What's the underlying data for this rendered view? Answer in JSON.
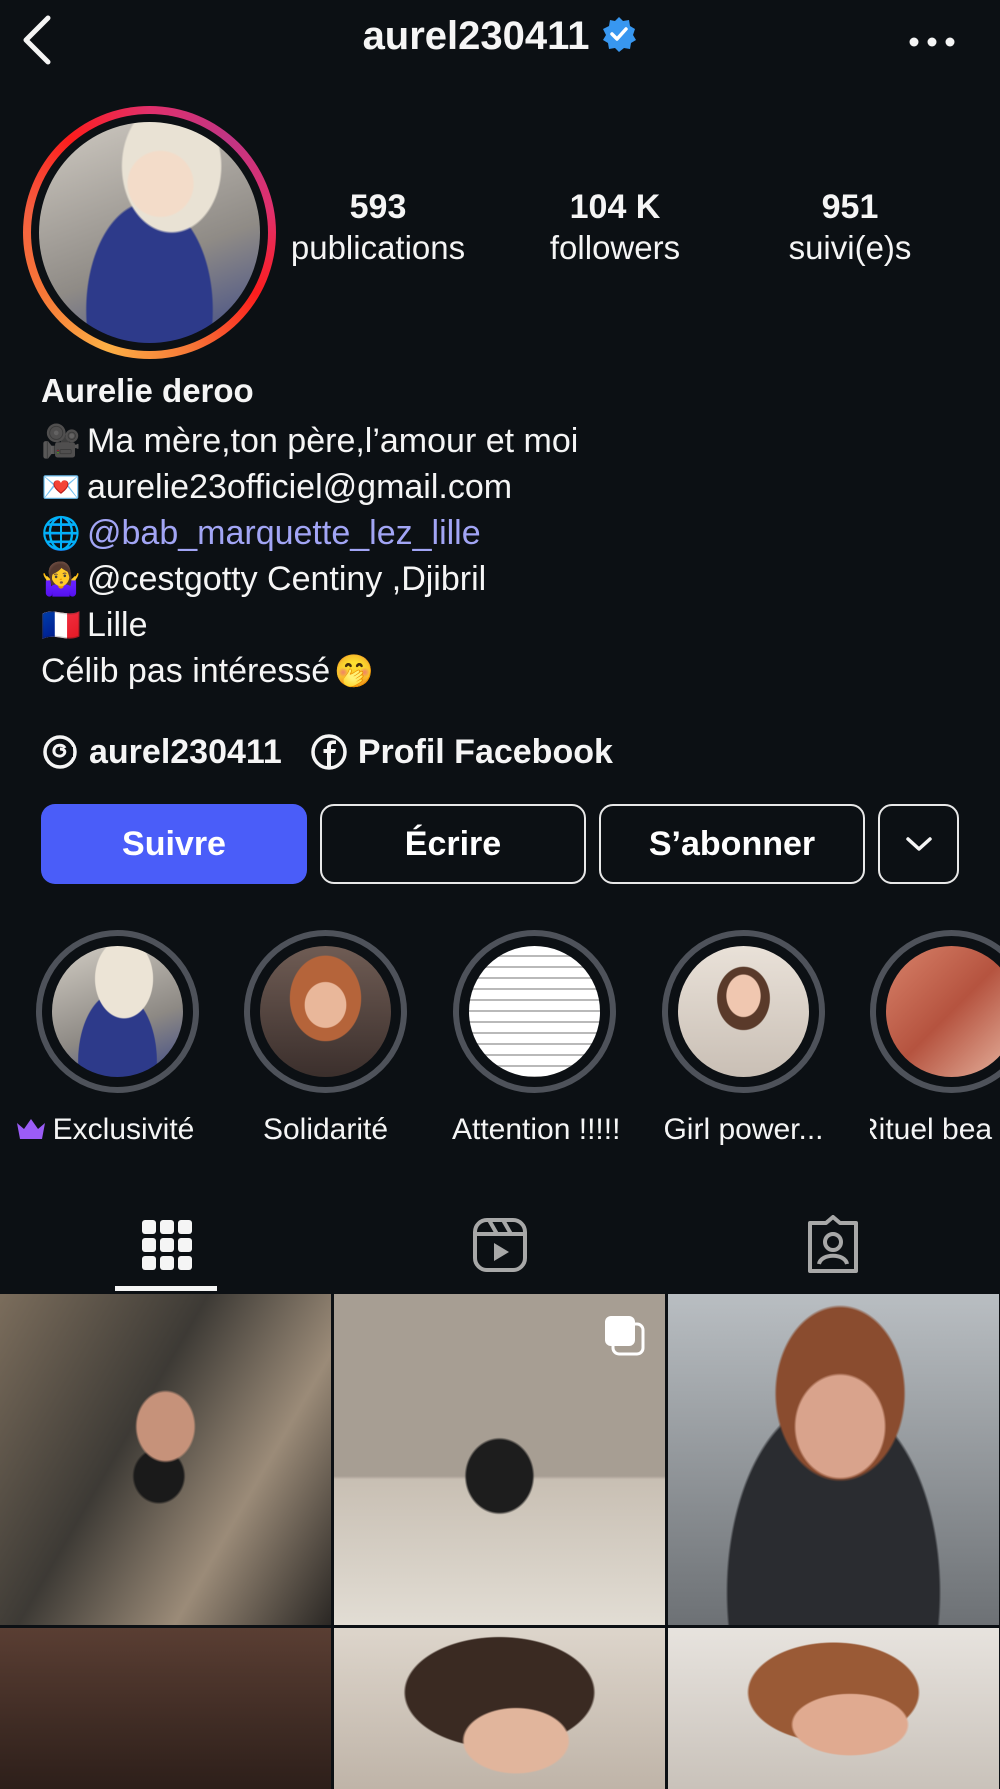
{
  "header": {
    "back_icon": "chevron-left-icon",
    "username": "aurel230411",
    "verified_icon": "verified-badge-icon",
    "verified_color": "#3897f0",
    "more_icon": "more-horizontal-icon"
  },
  "stats": [
    {
      "value": "593",
      "label": "publications"
    },
    {
      "value": "104 K",
      "label": "followers"
    },
    {
      "value": "951",
      "label": "suivi(e)s"
    }
  ],
  "bio": {
    "name": "Aurelie deroo",
    "lines": [
      {
        "emoji": "🎥",
        "text": "Ma mère,ton père,l’amour et moi"
      },
      {
        "emoji": "💌",
        "text": "aurelie23officiel@gmail.com"
      },
      {
        "emoji": "🌐",
        "text": "@bab_marquette_lez_lille"
      },
      {
        "emoji": "🤷‍♀️",
        "text": "@cestgotty Centiny ,Djibril"
      },
      {
        "emoji": "🇫🇷",
        "text": "Lille"
      },
      {
        "emoji": "🤭",
        "text": "Célib pas intéressé"
      }
    ],
    "link_color": "#a2a5f5"
  },
  "profile_links": [
    {
      "icon": "threads-icon",
      "label": "aurel230411"
    },
    {
      "icon": "facebook-icon",
      "label": "Profil Facebook"
    }
  ],
  "actions": {
    "follow": "Suivre",
    "message": "Écrire",
    "subscribe": "S’abonner",
    "dropdown_icon": "chevron-down-icon",
    "primary_color": "#4a5df9"
  },
  "highlights": [
    {
      "label": "Exclusivité",
      "badge_icon": "crown-icon"
    },
    {
      "label": "Solidarité"
    },
    {
      "label": "Attention !!!!!"
    },
    {
      "label": "Girl power..."
    },
    {
      "label": "Rituel bea"
    }
  ],
  "tabs": [
    {
      "icon": "grid-icon",
      "active": true
    },
    {
      "icon": "reels-icon",
      "active": false
    },
    {
      "icon": "tagged-icon",
      "active": false
    }
  ],
  "posts": [
    {
      "type": "photo"
    },
    {
      "type": "carousel",
      "icon": "carousel-icon"
    },
    {
      "type": "photo"
    },
    {
      "type": "photo"
    },
    {
      "type": "photo"
    },
    {
      "type": "photo"
    }
  ]
}
